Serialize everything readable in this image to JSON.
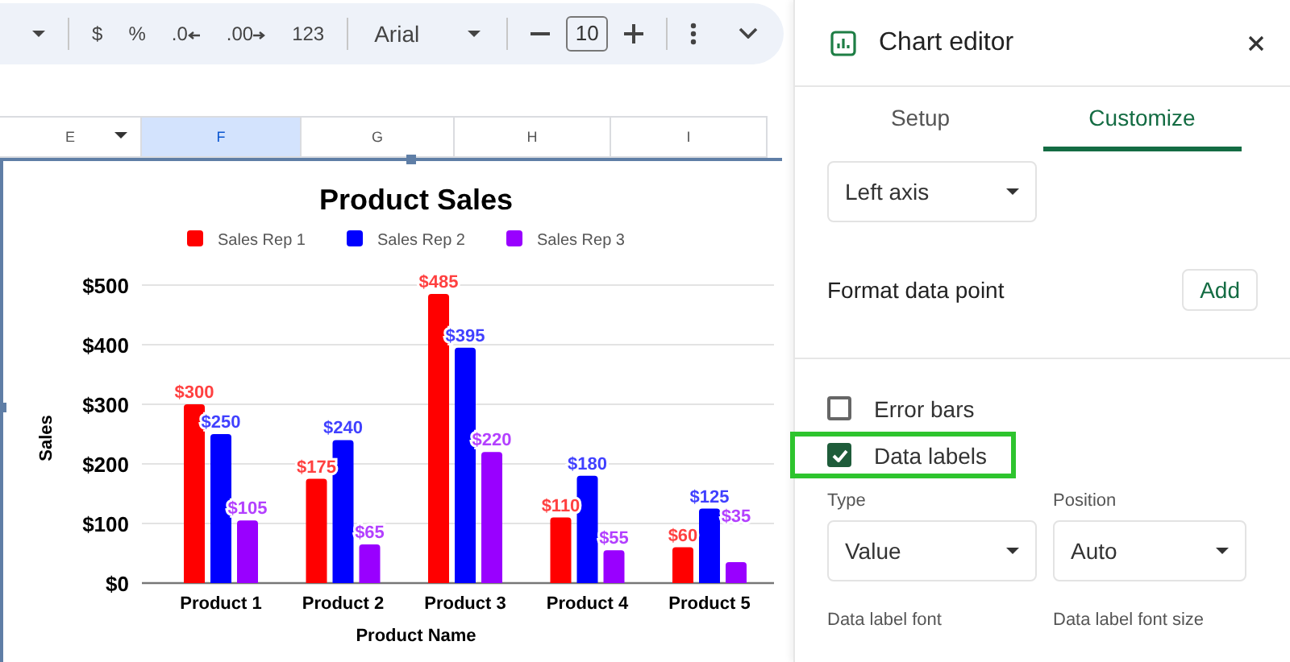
{
  "toolbar": {
    "buttons": [
      {
        "kind": "plain",
        "label": "$"
      },
      {
        "kind": "plain",
        "label": "%"
      },
      {
        "kind": "arrow-left",
        "label": ".0"
      },
      {
        "kind": "arrow-right",
        "label": ".00"
      },
      {
        "kind": "plain",
        "label": "123"
      }
    ],
    "font": "Arial",
    "font_size": "10"
  },
  "columns": [
    {
      "label": "E",
      "selected": false,
      "menu": true
    },
    {
      "label": "F",
      "selected": true,
      "menu": false
    },
    {
      "label": "G",
      "selected": false,
      "menu": false
    },
    {
      "label": "H",
      "selected": false,
      "menu": false
    },
    {
      "label": "I",
      "selected": false,
      "menu": false
    }
  ],
  "chart_data": {
    "type": "bar",
    "title": "Product Sales",
    "xlabel": "Product Name",
    "ylabel": "Sales",
    "categories": [
      "Product 1",
      "Product 2",
      "Product 3",
      "Product 4",
      "Product 5"
    ],
    "series": [
      {
        "name": "Sales Rep 1",
        "color": "#ff0000",
        "values": [
          300,
          175,
          485,
          110,
          60
        ]
      },
      {
        "name": "Sales Rep 2",
        "color": "#0000ff",
        "values": [
          250,
          240,
          395,
          180,
          125
        ]
      },
      {
        "name": "Sales Rep 3",
        "color": "#9900ff",
        "values": [
          105,
          65,
          220,
          55,
          35
        ]
      }
    ],
    "ylim": [
      0,
      500
    ],
    "yticks": [
      {
        "value": 0,
        "label": "$0"
      },
      {
        "value": 100,
        "label": "$100"
      },
      {
        "value": 200,
        "label": "$200"
      },
      {
        "value": 300,
        "label": "$300"
      },
      {
        "value": 400,
        "label": "$400"
      },
      {
        "value": 500,
        "label": "$500"
      }
    ],
    "value_labels": [
      "$300",
      "$175",
      "$485",
      "$110",
      "$60",
      "$250",
      "$240",
      "$395",
      "$180",
      "$125",
      "$105",
      "$65",
      "$220",
      "$55",
      "$35"
    ],
    "grid": true,
    "legend": "top"
  },
  "editor": {
    "title": "Chart editor",
    "tabs": [
      {
        "label": "Setup",
        "selected": false
      },
      {
        "label": "Customize",
        "selected": true
      }
    ],
    "axis_dropdown": "Left axis",
    "format_data_point": {
      "label": "Format data point",
      "button": "Add"
    },
    "checkboxes": [
      {
        "label": "Error bars",
        "checked": false,
        "highlighted": false
      },
      {
        "label": "Data labels",
        "checked": true,
        "highlighted": true
      }
    ],
    "selects": [
      {
        "label": "Type",
        "value": "Value"
      },
      {
        "label": "Position",
        "value": "Auto"
      }
    ],
    "font_labels": [
      "Data label font",
      "Data label font size"
    ]
  }
}
